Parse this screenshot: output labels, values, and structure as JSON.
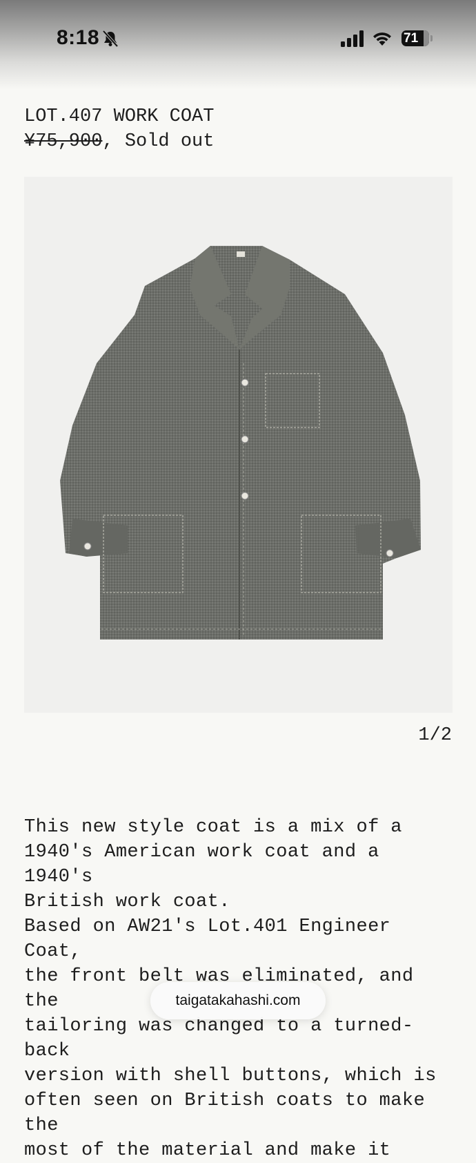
{
  "status_bar": {
    "time": "8:18",
    "battery": "71",
    "icons": [
      "bell-slash-icon",
      "cellular-signal-icon",
      "wifi-icon",
      "battery-icon"
    ]
  },
  "product": {
    "title": "LOT.407 WORK COAT",
    "price_original": "¥75,900",
    "price_separator": ", ",
    "availability": "Sold out",
    "image_counter": "1/2",
    "description": "This new style coat is a mix of a\n1940's American work coat and a 1940's\nBritish work coat.\nBased on AW21's Lot.401 Engineer Coat,\nthe front belt was eliminated, and the\ntailoring was changed to a turned-back\nversion with shell buttons, which is\noften seen on British coats to make the\nmost of the material and make it"
  },
  "browser": {
    "url": "taigatakahashi.com"
  },
  "colors": {
    "background": "#f8f8f5",
    "image_background": "#f0f0ee",
    "coat": "#6b6d68",
    "text": "#1d1d1d"
  }
}
